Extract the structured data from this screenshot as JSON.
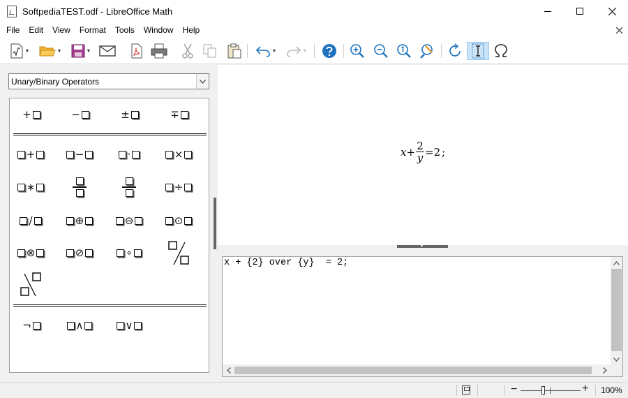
{
  "window": {
    "title": "SoftpediaTEST.odf - LibreOffice Math"
  },
  "menu": {
    "items": [
      "File",
      "Edit",
      "View",
      "Format",
      "Tools",
      "Window",
      "Help"
    ]
  },
  "toolbar": {
    "icons": [
      "formula-new-icon",
      "open-folder-icon",
      "save-icon",
      "email-icon",
      "export-pdf-icon",
      "print-icon",
      "cut-icon",
      "copy-icon",
      "paste-icon",
      "undo-icon",
      "redo-icon",
      "help-icon",
      "zoom-in-icon",
      "zoom-out-icon",
      "zoom-100-icon",
      "show-all-icon",
      "update-icon",
      "formula-cursor-icon",
      "symbols-icon"
    ],
    "accent": "#1e73be",
    "active_bg": "#cce4f7"
  },
  "elements_panel": {
    "category": "Unary/Binary Operators",
    "unary_row": [
      {
        "sym": "+",
        "layout": "prefix"
      },
      {
        "sym": "−",
        "layout": "prefix"
      },
      {
        "sym": "±",
        "layout": "prefix"
      },
      {
        "sym": "∓",
        "layout": "prefix"
      }
    ],
    "binary_rows": [
      [
        {
          "sym": "+"
        },
        {
          "sym": "−"
        },
        {
          "sym": "·"
        },
        {
          "sym": "×"
        }
      ],
      [
        {
          "sym": "∗"
        },
        {
          "sym": "",
          "layout": "frac"
        },
        {
          "sym": "",
          "layout": "frac"
        },
        {
          "sym": "÷"
        }
      ],
      [
        {
          "sym": "/"
        },
        {
          "sym": "⊕"
        },
        {
          "sym": "⊖"
        },
        {
          "sym": "⊙"
        }
      ],
      [
        {
          "sym": "⊗"
        },
        {
          "sym": "⊘"
        },
        {
          "sym": "∘"
        },
        {
          "sym": "",
          "layout": "wideslash"
        }
      ],
      [
        {
          "sym": "",
          "layout": "widebslash"
        }
      ]
    ],
    "logic_row": [
      {
        "sym": "¬",
        "layout": "prefix"
      },
      {
        "sym": "∧"
      },
      {
        "sym": "∨"
      }
    ]
  },
  "preview": {
    "var_x": "x",
    "plus": "+",
    "numerator": "2",
    "denominator": "y",
    "equals": "=",
    "rhs": "2",
    "semicolon": ";"
  },
  "editor": {
    "text": "x + {2} over {y}  = 2;"
  },
  "statusbar": {
    "zoom_level": "100%",
    "zoom_slider_fraction": 0.38
  }
}
